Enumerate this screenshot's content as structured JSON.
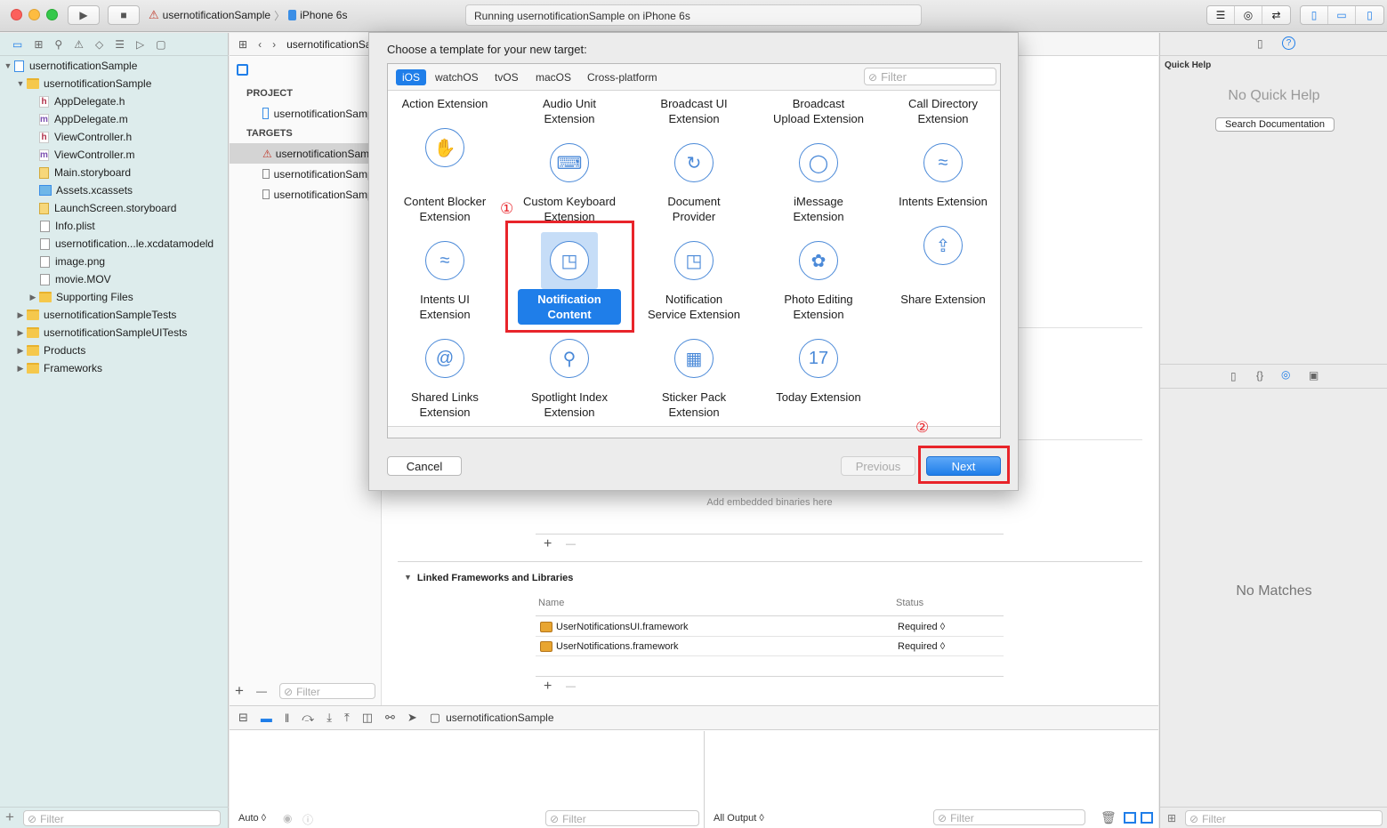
{
  "toolbar": {
    "scheme_name": "usernotificationSample",
    "scheme_separator": "〉",
    "device": "iPhone 6s",
    "activity_text": "Running usernotificationSample on iPhone 6s"
  },
  "navigator": {
    "items": [
      {
        "label": "usernotificationSample",
        "icon": "project-icon",
        "level": 0,
        "disclosure": "▼"
      },
      {
        "label": "usernotificationSample",
        "icon": "folder-icon",
        "level": 1,
        "disclosure": "▼"
      },
      {
        "label": "AppDelegate.h",
        "icon": "h",
        "level": 2,
        "disclosure": ""
      },
      {
        "label": "AppDelegate.m",
        "icon": "m",
        "level": 2,
        "disclosure": ""
      },
      {
        "label": "ViewController.h",
        "icon": "h",
        "level": 2,
        "disclosure": ""
      },
      {
        "label": "ViewController.m",
        "icon": "m",
        "level": 2,
        "disclosure": ""
      },
      {
        "label": "Main.storyboard",
        "icon": "storyboard-icon",
        "level": 2,
        "disclosure": ""
      },
      {
        "label": "Assets.xcassets",
        "icon": "assets-icon",
        "level": 2,
        "disclosure": ""
      },
      {
        "label": "LaunchScreen.storyboard",
        "icon": "storyboard-icon",
        "level": 2,
        "disclosure": ""
      },
      {
        "label": "Info.plist",
        "icon": "plist-icon",
        "level": 2,
        "disclosure": ""
      },
      {
        "label": "usernotification...le.xcdatamodeld",
        "icon": "datamodel-icon",
        "level": 2,
        "disclosure": ""
      },
      {
        "label": "image.png",
        "icon": "image-icon",
        "level": 2,
        "disclosure": ""
      },
      {
        "label": "movie.MOV",
        "icon": "movie-icon",
        "level": 2,
        "disclosure": ""
      },
      {
        "label": "Supporting Files",
        "icon": "folder-icon",
        "level": 2,
        "disclosure": "▶"
      },
      {
        "label": "usernotificationSampleTests",
        "icon": "folder-icon",
        "level": 1,
        "disclosure": "▶"
      },
      {
        "label": "usernotificationSampleUITests",
        "icon": "folder-icon",
        "level": 1,
        "disclosure": "▶"
      },
      {
        "label": "Products",
        "icon": "folder-icon",
        "level": 1,
        "disclosure": "▶"
      },
      {
        "label": "Frameworks",
        "icon": "folder-icon",
        "level": 1,
        "disclosure": "▶"
      }
    ],
    "filter_placeholder": "Filter"
  },
  "editor": {
    "jump_label": "usernotificationSample",
    "project_header": "PROJECT",
    "targets_header": "TARGETS",
    "project_item": "usernotificationSample",
    "targets": [
      "usernotificationSample",
      "usernotificationSample",
      "usernotificationSample"
    ],
    "filter_placeholder": "Filter",
    "embedded_placeholder": "Add embedded binaries here",
    "linked_title": "Linked Frameworks and Libraries",
    "col_name": "Name",
    "col_status": "Status",
    "frameworks": [
      {
        "name": "UserNotificationsUI.framework",
        "status": "Required ◊"
      },
      {
        "name": "UserNotifications.framework",
        "status": "Required ◊"
      }
    ],
    "plus": "+",
    "minus": "—"
  },
  "debug": {
    "target_label": "usernotificationSample",
    "auto_label": "Auto ◊",
    "output_label": "All Output ◊",
    "filter_placeholder": "Filter"
  },
  "inspector": {
    "quick_help_title": "Quick Help",
    "no_quick_help": "No Quick Help",
    "search_docs": "Search Documentation",
    "no_matches": "No Matches",
    "filter_placeholder": "Filter"
  },
  "modal": {
    "title": "Choose a template for your new target:",
    "tabs": [
      "iOS",
      "watchOS",
      "tvOS",
      "macOS",
      "Cross-platform"
    ],
    "selected_tab": "iOS",
    "filter_placeholder": "Filter",
    "templates": [
      {
        "label": "Action Extension",
        "icon": "hand-icon",
        "glyph": "✋"
      },
      {
        "label": "Audio Unit\nExtension",
        "icon": "keyboard-icon",
        "glyph": "⌨"
      },
      {
        "label": "Broadcast UI\nExtension",
        "icon": "refresh-icon",
        "glyph": "↻"
      },
      {
        "label": "Broadcast\nUpload Extension",
        "icon": "speech-bubble-icon",
        "glyph": "◯"
      },
      {
        "label": "Call Directory\nExtension",
        "icon": "wave-icon",
        "glyph": "≈"
      },
      {
        "label": "Content Blocker\nExtension",
        "icon": "hand-icon",
        "glyph": "✋"
      },
      {
        "label": "Custom Keyboard\nExtension",
        "icon": "keyboard-icon",
        "glyph": "⌨"
      },
      {
        "label": "Document\nProvider",
        "icon": "refresh-icon",
        "glyph": "↻"
      },
      {
        "label": "iMessage\nExtension",
        "icon": "speech-bubble-icon",
        "glyph": "◯"
      },
      {
        "label": "Intents Extension",
        "icon": "wave-icon",
        "glyph": "≈"
      },
      {
        "label": "Intents UI\nExtension",
        "icon": "wave-icon",
        "glyph": "≈"
      },
      {
        "label": "Notification\nContent",
        "icon": "notification-icon",
        "glyph": "◳",
        "selected": true
      },
      {
        "label": "Notification\nService Extension",
        "icon": "notification-icon",
        "glyph": "◳"
      },
      {
        "label": "Photo Editing\nExtension",
        "icon": "flower-icon",
        "glyph": "✿"
      },
      {
        "label": "Share Extension",
        "icon": "share-icon",
        "glyph": "⇪"
      },
      {
        "label": "Shared Links\nExtension",
        "icon": "at-icon",
        "glyph": "@"
      },
      {
        "label": "Spotlight Index\nExtension",
        "icon": "magnifier-icon",
        "glyph": "⚲"
      },
      {
        "label": "Sticker Pack\nExtension",
        "icon": "grid-icon",
        "glyph": "▦"
      },
      {
        "label": "Today Extension",
        "icon": "calendar-icon",
        "glyph": "17"
      }
    ],
    "cancel_label": "Cancel",
    "previous_label": "Previous",
    "next_label": "Next",
    "annotation_1": "①",
    "annotation_2": "②"
  },
  "colors": {
    "accent": "#1f7ee9",
    "annotation": "#e8242a",
    "navigator_bg": "#ddecec"
  }
}
